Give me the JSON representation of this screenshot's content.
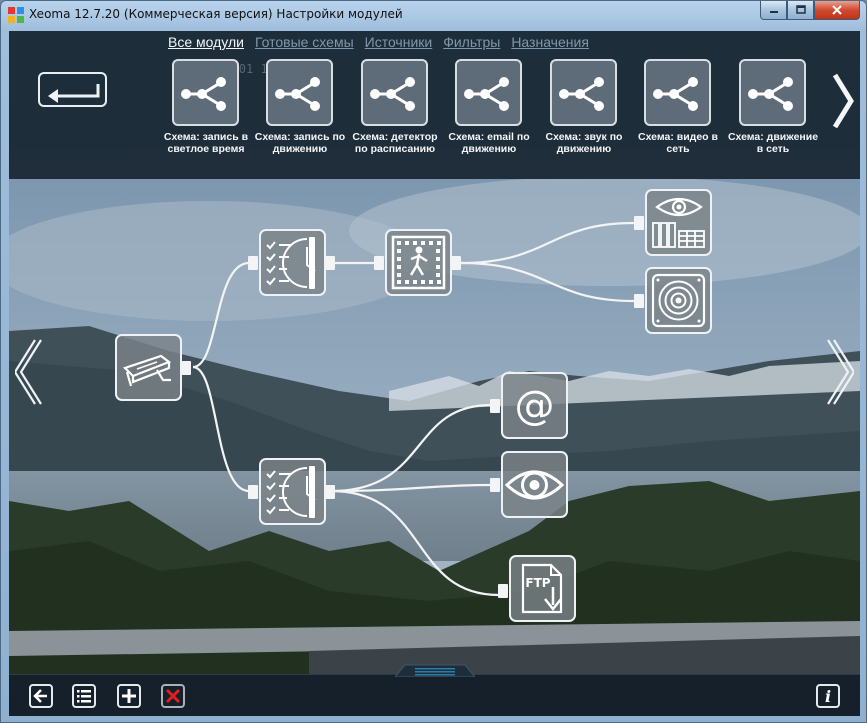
{
  "window": {
    "title": "Xeoma 12.7.20 (Коммерческая версия) Настройки модулей",
    "minimize_icon": "minimize-icon",
    "maximize_icon": "maximize-icon",
    "close_icon": "close-icon"
  },
  "top_tabs": [
    {
      "label": "Все модули",
      "active": true
    },
    {
      "label": "Готовые схемы",
      "active": false
    },
    {
      "label": "Источники",
      "active": false
    },
    {
      "label": "Фильтры",
      "active": false
    },
    {
      "label": "Назначения",
      "active": false
    }
  ],
  "background_timestamp": "2005-06-01 19:05:3",
  "schemes": [
    {
      "label": "Схема: запись в светлое время"
    },
    {
      "label": "Схема: запись по движению"
    },
    {
      "label": "Схема: детектор по расписанию"
    },
    {
      "label": "Схема: email по движению"
    },
    {
      "label": "Схема: звук по движению"
    },
    {
      "label": "Схема: видео в сеть"
    },
    {
      "label": "Схема: движение в сеть"
    }
  ],
  "modules": [
    {
      "name": "camera",
      "icon": "camera-icon"
    },
    {
      "name": "scheduler-top",
      "icon": "scheduler-icon"
    },
    {
      "name": "motion-detector",
      "icon": "motion-detector-icon"
    },
    {
      "name": "preview-archive",
      "icon": "preview-archive-icon"
    },
    {
      "name": "sound-alarm",
      "icon": "speaker-icon"
    },
    {
      "name": "scheduler-bottom",
      "icon": "scheduler-icon"
    },
    {
      "name": "email",
      "icon": "email-at-icon"
    },
    {
      "name": "preview",
      "icon": "eye-icon"
    },
    {
      "name": "ftp-upload",
      "icon": "ftp-upload-icon"
    }
  ],
  "ftp_label": "FTP",
  "email_symbol": "@",
  "bottom_bar": {
    "back_icon": "back-arrow-icon",
    "list_icon": "list-icon",
    "add_icon": "add-icon",
    "delete_icon": "delete-icon",
    "info_icon": "info-icon",
    "info_label": "i"
  },
  "colors": {
    "panel": "#18263a",
    "accent_handle": "#2a7fa8",
    "delete_red": "#e0201c",
    "module_border": "#eef2f5"
  }
}
